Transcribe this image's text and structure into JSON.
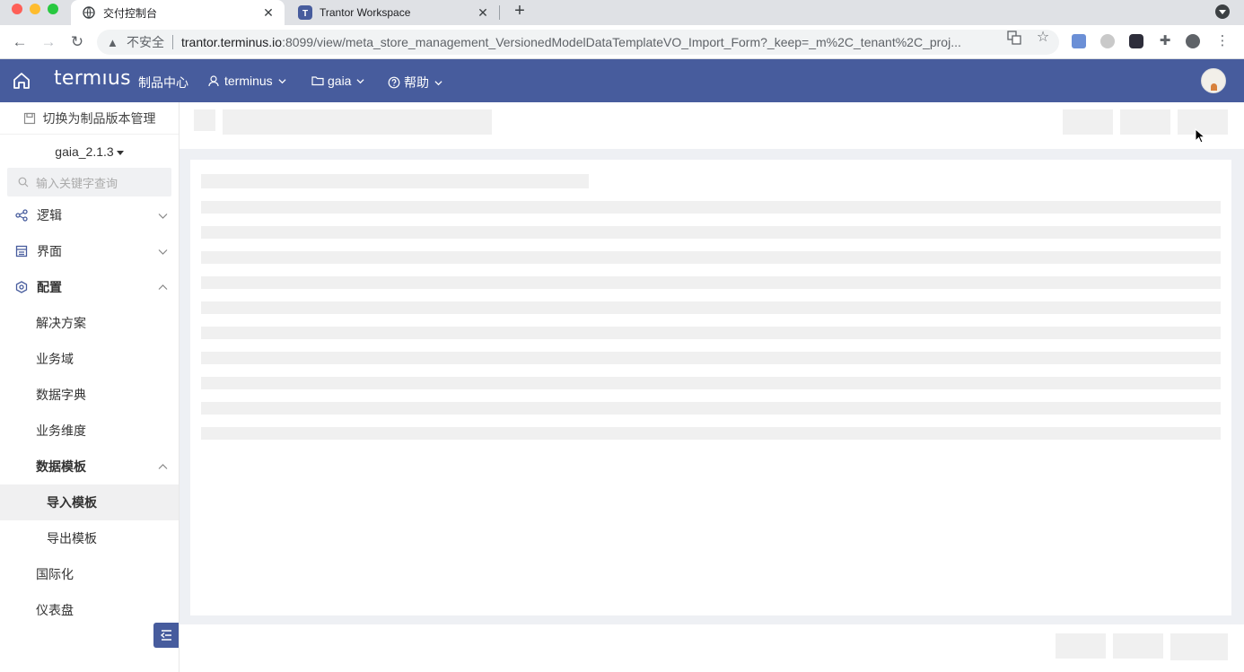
{
  "browser": {
    "tabs": [
      {
        "title": "交付控制台",
        "active": true
      },
      {
        "title": "Trantor Workspace",
        "active": false
      }
    ],
    "new_tab": "+",
    "security_label": "不安全",
    "url_host": "trantor.terminus.io",
    "url_rest": ":8099/view/meta_store_management_VersionedModelDataTemplateVO_Import_Form?_keep=_m%2C_tenant%2C_proj..."
  },
  "app": {
    "brand": "termıus",
    "product": "制品中心",
    "menus": {
      "user": "terminus",
      "project": "gaia",
      "help": "帮助"
    },
    "accent_color": "#475c9d"
  },
  "sidebar": {
    "switch_label": "切换为制品版本管理",
    "version": "gaia_2.1.3",
    "search_placeholder": "输入关键字查询",
    "sections": {
      "logic": "逻辑",
      "ui": "界面",
      "config": "配置"
    },
    "config_items": {
      "solution": "解决方案",
      "business_domain": "业务域",
      "data_dictionary": "数据字典",
      "business_dimension": "业务维度",
      "data_template": "数据模板",
      "import_template": "导入模板",
      "export_template": "导出模板",
      "i18n": "国际化",
      "dashboard": "仪表盘"
    },
    "selected": "导入模板"
  },
  "main": {
    "state": "loading-skeleton",
    "skeleton_rows": 10
  }
}
